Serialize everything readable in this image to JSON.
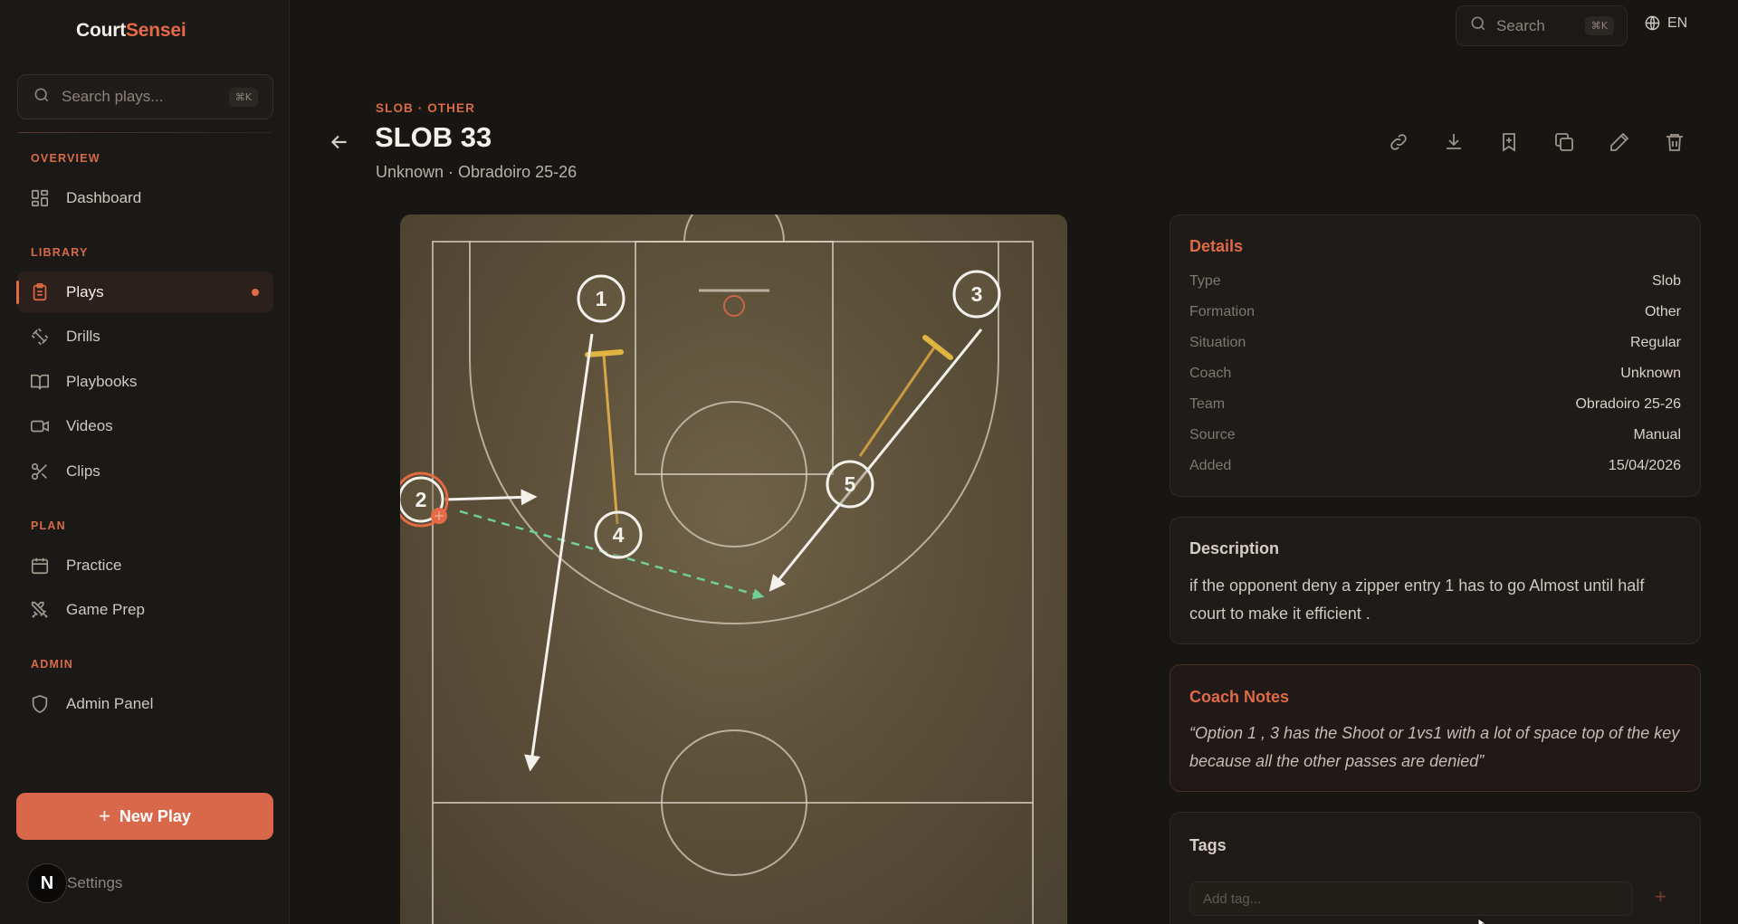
{
  "brand": {
    "part1": "Court",
    "part2": "Sensei"
  },
  "sidebar": {
    "search_placeholder": "Search plays...",
    "search_shortcut": "⌘K",
    "sections": {
      "overview": "OVERVIEW",
      "library": "LIBRARY",
      "plan": "PLAN",
      "admin": "ADMIN"
    },
    "items": {
      "dashboard": "Dashboard",
      "plays": "Plays",
      "drills": "Drills",
      "playbooks": "Playbooks",
      "videos": "Videos",
      "clips": "Clips",
      "practice": "Practice",
      "game_prep": "Game Prep",
      "admin_panel": "Admin Panel"
    },
    "new_play": "New Play",
    "settings": "Settings",
    "user_initial": "N"
  },
  "topbar": {
    "search_placeholder": "Search",
    "search_shortcut": "⌘K",
    "language": "EN"
  },
  "play": {
    "breadcrumb": "SLOB · OTHER",
    "title": "SLOB 33",
    "subtitle": "Unknown · Obradoiro 25-26"
  },
  "court": {
    "players": [
      {
        "label": "1"
      },
      {
        "label": "2"
      },
      {
        "label": "3"
      },
      {
        "label": "4"
      },
      {
        "label": "5"
      }
    ],
    "colors": {
      "cut": "#f4f1ec",
      "screen": "#e0b441",
      "pass": "#6fcf97",
      "ball": "#e36a45"
    }
  },
  "details": {
    "title": "Details",
    "rows": [
      {
        "key": "Type",
        "value": "Slob"
      },
      {
        "key": "Formation",
        "value": "Other"
      },
      {
        "key": "Situation",
        "value": "Regular"
      },
      {
        "key": "Coach",
        "value": "Unknown"
      },
      {
        "key": "Team",
        "value": "Obradoiro 25-26"
      },
      {
        "key": "Source",
        "value": "Manual"
      },
      {
        "key": "Added",
        "value": "15/04/2026"
      }
    ]
  },
  "description": {
    "title": "Description",
    "text": "if the opponent deny a zipper entry 1 has to go Almost until half court to make it efficient ."
  },
  "coach_notes": {
    "title": "Coach Notes",
    "text": "“Option 1 , 3 has the Shoot or 1vs1 with a lot of space top of the key because all the other passes are denied”"
  },
  "tags": {
    "title": "Tags",
    "placeholder": "Add tag...",
    "add": "+"
  },
  "theme": {
    "accent": "#e36a45",
    "background": "#181613",
    "card": "#1e1b18"
  }
}
